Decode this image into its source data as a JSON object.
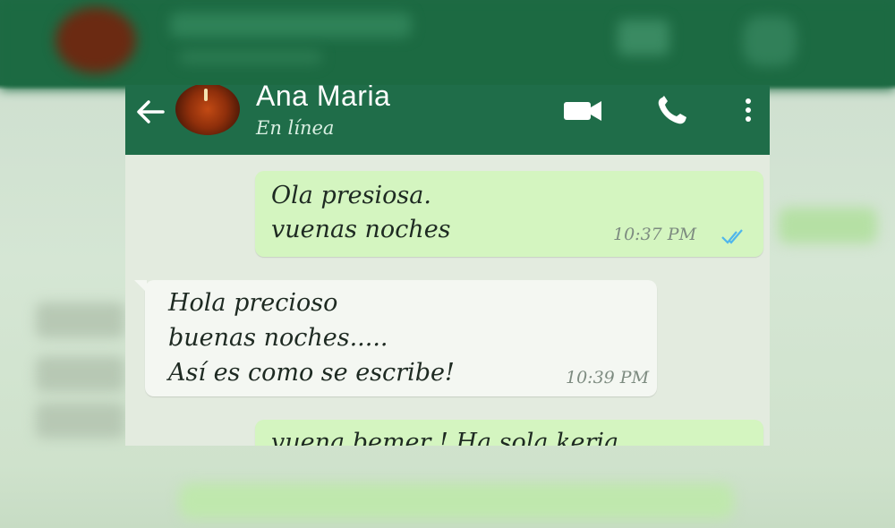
{
  "header": {
    "contact_name": "Ana Maria",
    "status": "En línea"
  },
  "messages": [
    {
      "direction": "outgoing",
      "lines": [
        "Ola presiosa.",
        "vuenas noches"
      ],
      "time": "10:37 PM",
      "read": true
    },
    {
      "direction": "incoming",
      "lines": [
        "Hola precioso",
        "buenas noches.....",
        "Así es como se escribe!"
      ],
      "time": "10:39 PM"
    },
    {
      "direction": "outgoing",
      "lines": [
        "vuena bemer ! Ha sola keria"
      ],
      "time": ""
    }
  ],
  "icons": [
    "back-arrow-icon",
    "video-call-icon",
    "phone-icon",
    "more-vert-icon",
    "double-check-icon"
  ],
  "colors": {
    "header": "#1f6d49",
    "outgoing_bubble": "#d4f5c0",
    "incoming_bubble": "#f4f7f2",
    "chat_background": "#e3ebdf",
    "read_ticks": "#4fb6ec"
  }
}
